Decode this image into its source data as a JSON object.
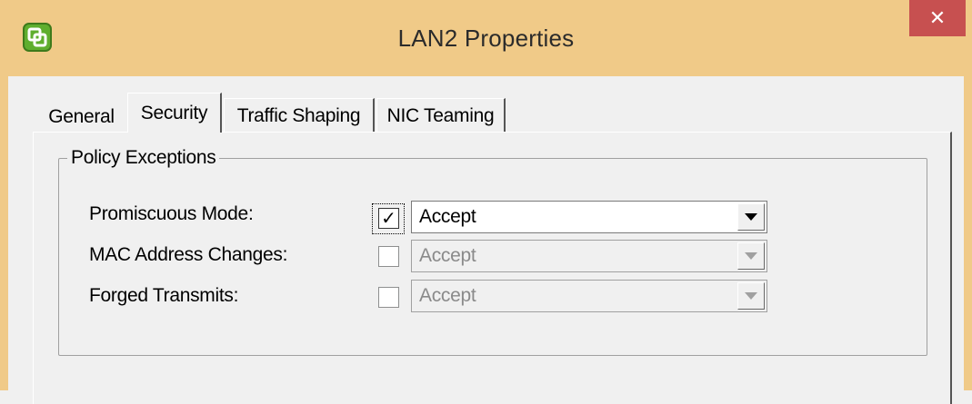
{
  "window": {
    "title": "LAN2 Properties",
    "close_symbol": "✕"
  },
  "colors": {
    "frame": "#f0ca88",
    "close": "#c75050",
    "dialog": "#f0f0f0"
  },
  "icons": {
    "app": "vmware-client-icon",
    "close": "close-icon",
    "dropdown": "chevron-down-icon",
    "check": "checkmark-icon"
  },
  "tabs": [
    {
      "label": "General",
      "selected": false
    },
    {
      "label": "Security",
      "selected": true
    },
    {
      "label": "Traffic Shaping",
      "selected": false
    },
    {
      "label": "NIC Teaming",
      "selected": false
    }
  ],
  "policy": {
    "group_title": "Policy Exceptions",
    "rows": [
      {
        "label": "Promiscuous Mode:",
        "checked": true,
        "check_symbol": "✓",
        "value": "Accept",
        "enabled": true
      },
      {
        "label": "MAC Address Changes:",
        "checked": false,
        "check_symbol": "",
        "value": "Accept",
        "enabled": false
      },
      {
        "label": "Forged Transmits:",
        "checked": false,
        "check_symbol": "",
        "value": "Accept",
        "enabled": false
      }
    ]
  }
}
